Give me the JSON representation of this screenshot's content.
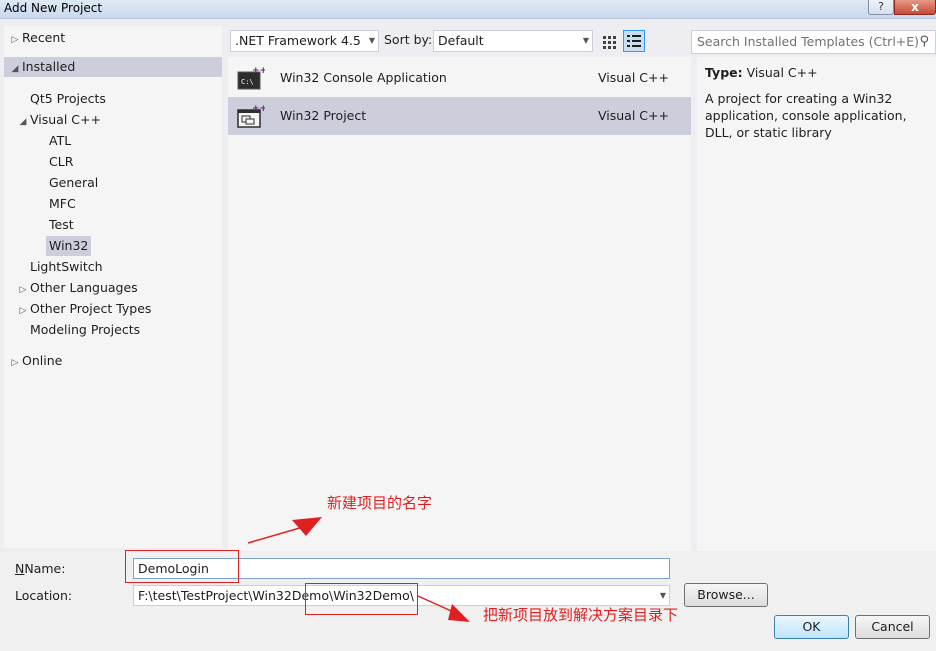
{
  "window": {
    "title": "Add New Project",
    "help_label": "?",
    "close_label": "x"
  },
  "tree": {
    "items": [
      {
        "label": "Recent",
        "arrow": "▷"
      },
      {
        "label": "Installed",
        "arrow": "◢"
      },
      {
        "label": "Qt5 Projects"
      },
      {
        "label": "Visual C++",
        "arrow": "◢"
      },
      {
        "label": "ATL"
      },
      {
        "label": "CLR"
      },
      {
        "label": "General"
      },
      {
        "label": "MFC"
      },
      {
        "label": "Test"
      },
      {
        "label": "Win32"
      },
      {
        "label": "LightSwitch"
      },
      {
        "label": "Other Languages",
        "arrow": "▷"
      },
      {
        "label": "Other Project Types",
        "arrow": "▷"
      },
      {
        "label": "Modeling Projects"
      },
      {
        "label": "Online",
        "arrow": "▷"
      }
    ]
  },
  "toolbar": {
    "framework": ".NET Framework 4.5",
    "sort_label": "Sort by:",
    "sort_value": "Default",
    "search_placeholder": "Search Installed Templates (Ctrl+E)"
  },
  "templates": [
    {
      "name": "Win32 Console Application",
      "lang": "Visual C++"
    },
    {
      "name": "Win32 Project",
      "lang": "Visual C++"
    }
  ],
  "description": {
    "type_label": "Type:",
    "type_value": "Visual C++",
    "text": "A project for creating a Win32 application, console application, DLL, or static library"
  },
  "form": {
    "name_label": "Name:",
    "name_value": "DemoLogin",
    "location_label": "Location:",
    "location_value": "F:\\test\\TestProject\\Win32Demo\\Win32Demo\\",
    "browse_label": "Browse...",
    "ok_label": "OK",
    "cancel_label": "Cancel"
  },
  "annotations": {
    "note1": "新建项目的名字",
    "note2": "把新项目放到解决方案目录下"
  },
  "colors": {
    "selection": "#cccedb",
    "annotation": "#e02020",
    "panel": "#f5f5f5"
  }
}
